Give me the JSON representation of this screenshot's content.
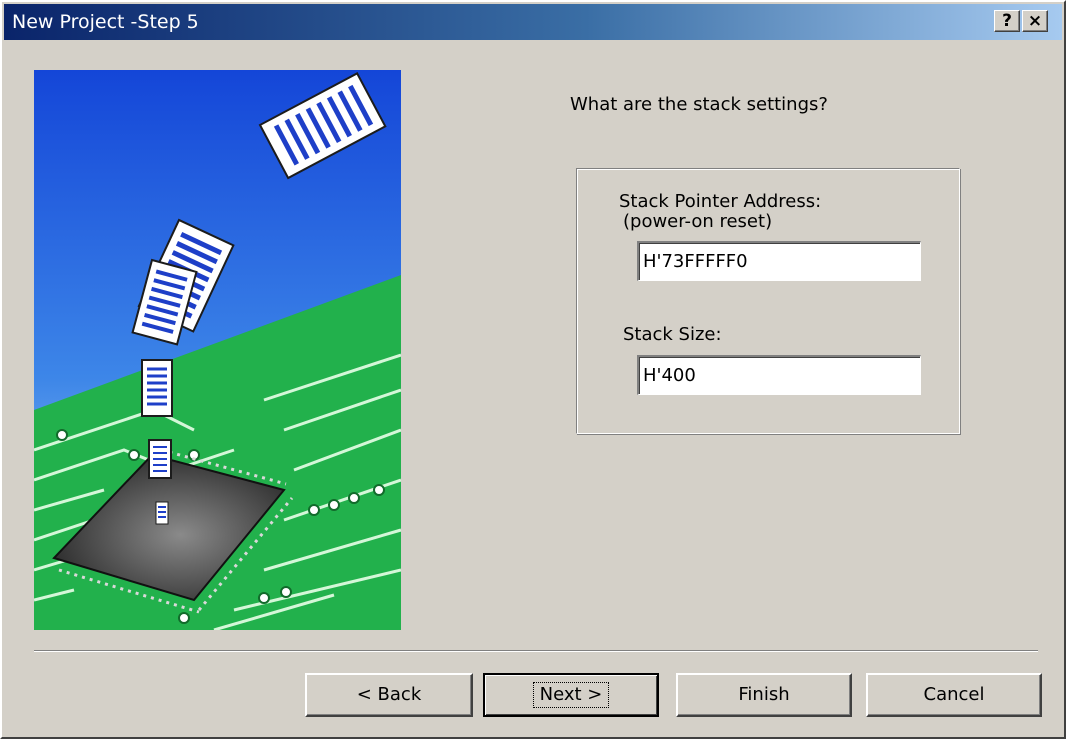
{
  "window": {
    "title": "New Project -Step 5",
    "help_glyph": "?",
    "close_glyph": "×"
  },
  "content": {
    "question": "What are the stack settings?"
  },
  "stack": {
    "pointer_label": "Stack Pointer Address:",
    "pointer_sublabel": "(power-on reset)",
    "pointer_value": "H'73FFFFF0",
    "size_label": "Stack Size:",
    "size_value": "H'400"
  },
  "buttons": {
    "back": "< Back",
    "next": "Next >",
    "finish": "Finish",
    "cancel": "Cancel"
  },
  "colors": {
    "titlebar_start": "#0a246a",
    "titlebar_end": "#a6caf0",
    "dialog_bg": "#d4d0c8",
    "art_sky": "#1a4fd0",
    "art_board": "#22b14c"
  },
  "icons": [
    "help-icon",
    "close-icon",
    "wizard-illustration"
  ]
}
